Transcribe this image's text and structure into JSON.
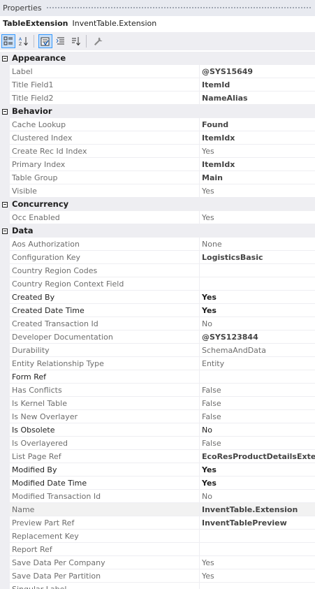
{
  "window": {
    "title": "Properties"
  },
  "object": {
    "name": "TableExtension",
    "kind": "InventTable.Extension"
  },
  "toolbar": {
    "buttons": [
      {
        "icon": "categorized-icon",
        "active": true
      },
      {
        "icon": "alphabetical-sort-icon",
        "active": false
      },
      {
        "icon": "properties-icon",
        "active": true
      },
      {
        "icon": "events-icon",
        "active": false
      },
      {
        "icon": "sort-order-icon",
        "active": false
      },
      {
        "icon": "property-pages-icon",
        "active": false
      }
    ]
  },
  "categories": [
    {
      "label": "Appearance",
      "rows": [
        {
          "name": "Label",
          "value": "@SYS15649",
          "bold": true
        },
        {
          "name": "Title Field1",
          "value": "ItemId",
          "bold": true
        },
        {
          "name": "Title Field2",
          "value": "NameAlias",
          "bold": true
        }
      ]
    },
    {
      "label": "Behavior",
      "rows": [
        {
          "name": "Cache Lookup",
          "value": "Found",
          "bold": true
        },
        {
          "name": "Clustered Index",
          "value": "ItemIdx",
          "bold": true
        },
        {
          "name": "Create Rec Id Index",
          "value": "Yes"
        },
        {
          "name": "Primary Index",
          "value": "ItemIdx",
          "bold": true
        },
        {
          "name": "Table Group",
          "value": "Main",
          "bold": true
        },
        {
          "name": "Visible",
          "value": "Yes"
        }
      ]
    },
    {
      "label": "Concurrency",
      "rows": [
        {
          "name": "Occ Enabled",
          "value": "Yes"
        }
      ]
    },
    {
      "label": "Data",
      "rows": [
        {
          "name": "Aos Authorization",
          "value": "None"
        },
        {
          "name": "Configuration Key",
          "value": "LogisticsBasic",
          "bold": true
        },
        {
          "name": "Country Region Codes",
          "value": ""
        },
        {
          "name": "Country Region Context Field",
          "value": ""
        },
        {
          "name": "Created By",
          "value": "Yes",
          "bold": true,
          "strong": true
        },
        {
          "name": "Created Date Time",
          "value": "Yes",
          "bold": true,
          "strong": true
        },
        {
          "name": "Created Transaction Id",
          "value": "No"
        },
        {
          "name": "Developer Documentation",
          "value": "@SYS123844",
          "bold": true
        },
        {
          "name": "Durability",
          "value": "SchemaAndData"
        },
        {
          "name": "Entity Relationship Type",
          "value": "Entity"
        },
        {
          "name": "Form Ref",
          "value": "",
          "strong": true
        },
        {
          "name": "Has Conflicts",
          "value": "False"
        },
        {
          "name": "Is Kernel Table",
          "value": "False"
        },
        {
          "name": "Is New Overlayer",
          "value": "False"
        },
        {
          "name": "Is Obsolete",
          "value": "No",
          "strong": true
        },
        {
          "name": "Is Overlayered",
          "value": "False"
        },
        {
          "name": "List Page Ref",
          "value": "EcoResProductDetailsExtende",
          "bold": true
        },
        {
          "name": "Modified By",
          "value": "Yes",
          "bold": true,
          "strong": true
        },
        {
          "name": "Modified Date Time",
          "value": "Yes",
          "bold": true,
          "strong": true
        },
        {
          "name": "Modified Transaction Id",
          "value": "No"
        },
        {
          "name": "Name",
          "value": "InventTable.Extension",
          "bold": true,
          "selected": true
        },
        {
          "name": "Preview Part Ref",
          "value": "InventTablePreview",
          "bold": true
        },
        {
          "name": "Replacement Key",
          "value": ""
        },
        {
          "name": "Report Ref",
          "value": ""
        },
        {
          "name": "Save Data Per Company",
          "value": "Yes"
        },
        {
          "name": "Save Data Per Partition",
          "value": "Yes"
        },
        {
          "name": "Singular Label",
          "value": ""
        }
      ]
    }
  ]
}
